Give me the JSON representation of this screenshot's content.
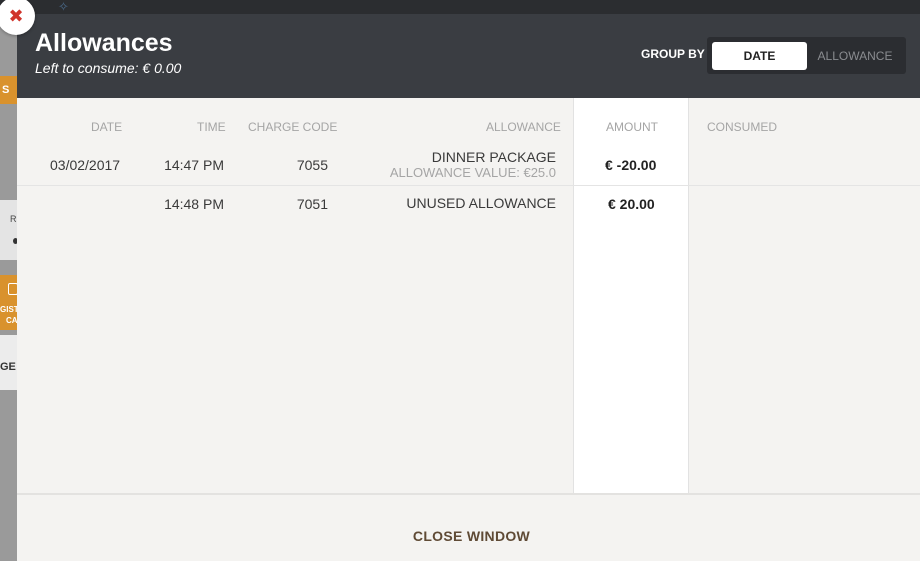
{
  "modal": {
    "title": "Allowances",
    "subtitle": "Left to consume: € 0.00",
    "group_by_label": "GROUP BY",
    "group_by_options": [
      "DATE",
      "ALLOWANCE"
    ],
    "group_by_selected": "DATE",
    "close_window_label": "CLOSE WINDOW"
  },
  "table": {
    "headers": {
      "date": "DATE",
      "time": "TIME",
      "charge_code": "CHARGE CODE",
      "allowance": "ALLOWANCE",
      "amount": "AMOUNT",
      "consumed": "CONSUMED"
    },
    "rows": [
      {
        "date": "03/02/2017",
        "time": "14:47 PM",
        "charge_code": "7055",
        "allowance": "DINNER PACKAGE",
        "allowance_detail": "ALLOWANCE VALUE: €25.0",
        "amount": "€ -20.00",
        "consumed": ""
      },
      {
        "date": "",
        "time": "14:48 PM",
        "charge_code": "7051",
        "allowance": "UNUSED ALLOWANCE",
        "allowance_detail": "",
        "amount": "€ 20.00",
        "consumed": ""
      }
    ]
  },
  "background": {
    "tab_fragment": "S",
    "strip_fragment": "R",
    "button_fragment_1": "GIST",
    "button_fragment_2": "CA",
    "label_fragment": "GE C"
  },
  "icons": {
    "close": "close-icon",
    "pin": "pin-icon"
  },
  "colors": {
    "header_bg": "#3a3d42",
    "close_x": "#d0332a",
    "accent_orange": "#d9922d",
    "close_window_text": "#5f4a35"
  }
}
